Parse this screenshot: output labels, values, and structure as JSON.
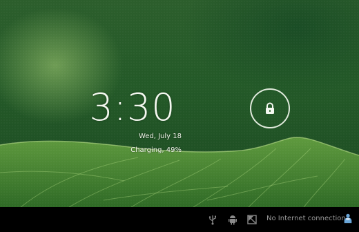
{
  "lockscreen": {
    "time": "3:30",
    "date": "Wed, July 18",
    "charging": "Charging, 49%"
  },
  "status_bar": {
    "network_text": "No Internet connection",
    "icons": [
      "usb-icon",
      "android-debug-icon",
      "screenshot-icon",
      "user-icon"
    ]
  },
  "colors": {
    "wallpaper_green": "#2c5e2c",
    "navbar": "#000000",
    "text": "#f4f8f0"
  }
}
